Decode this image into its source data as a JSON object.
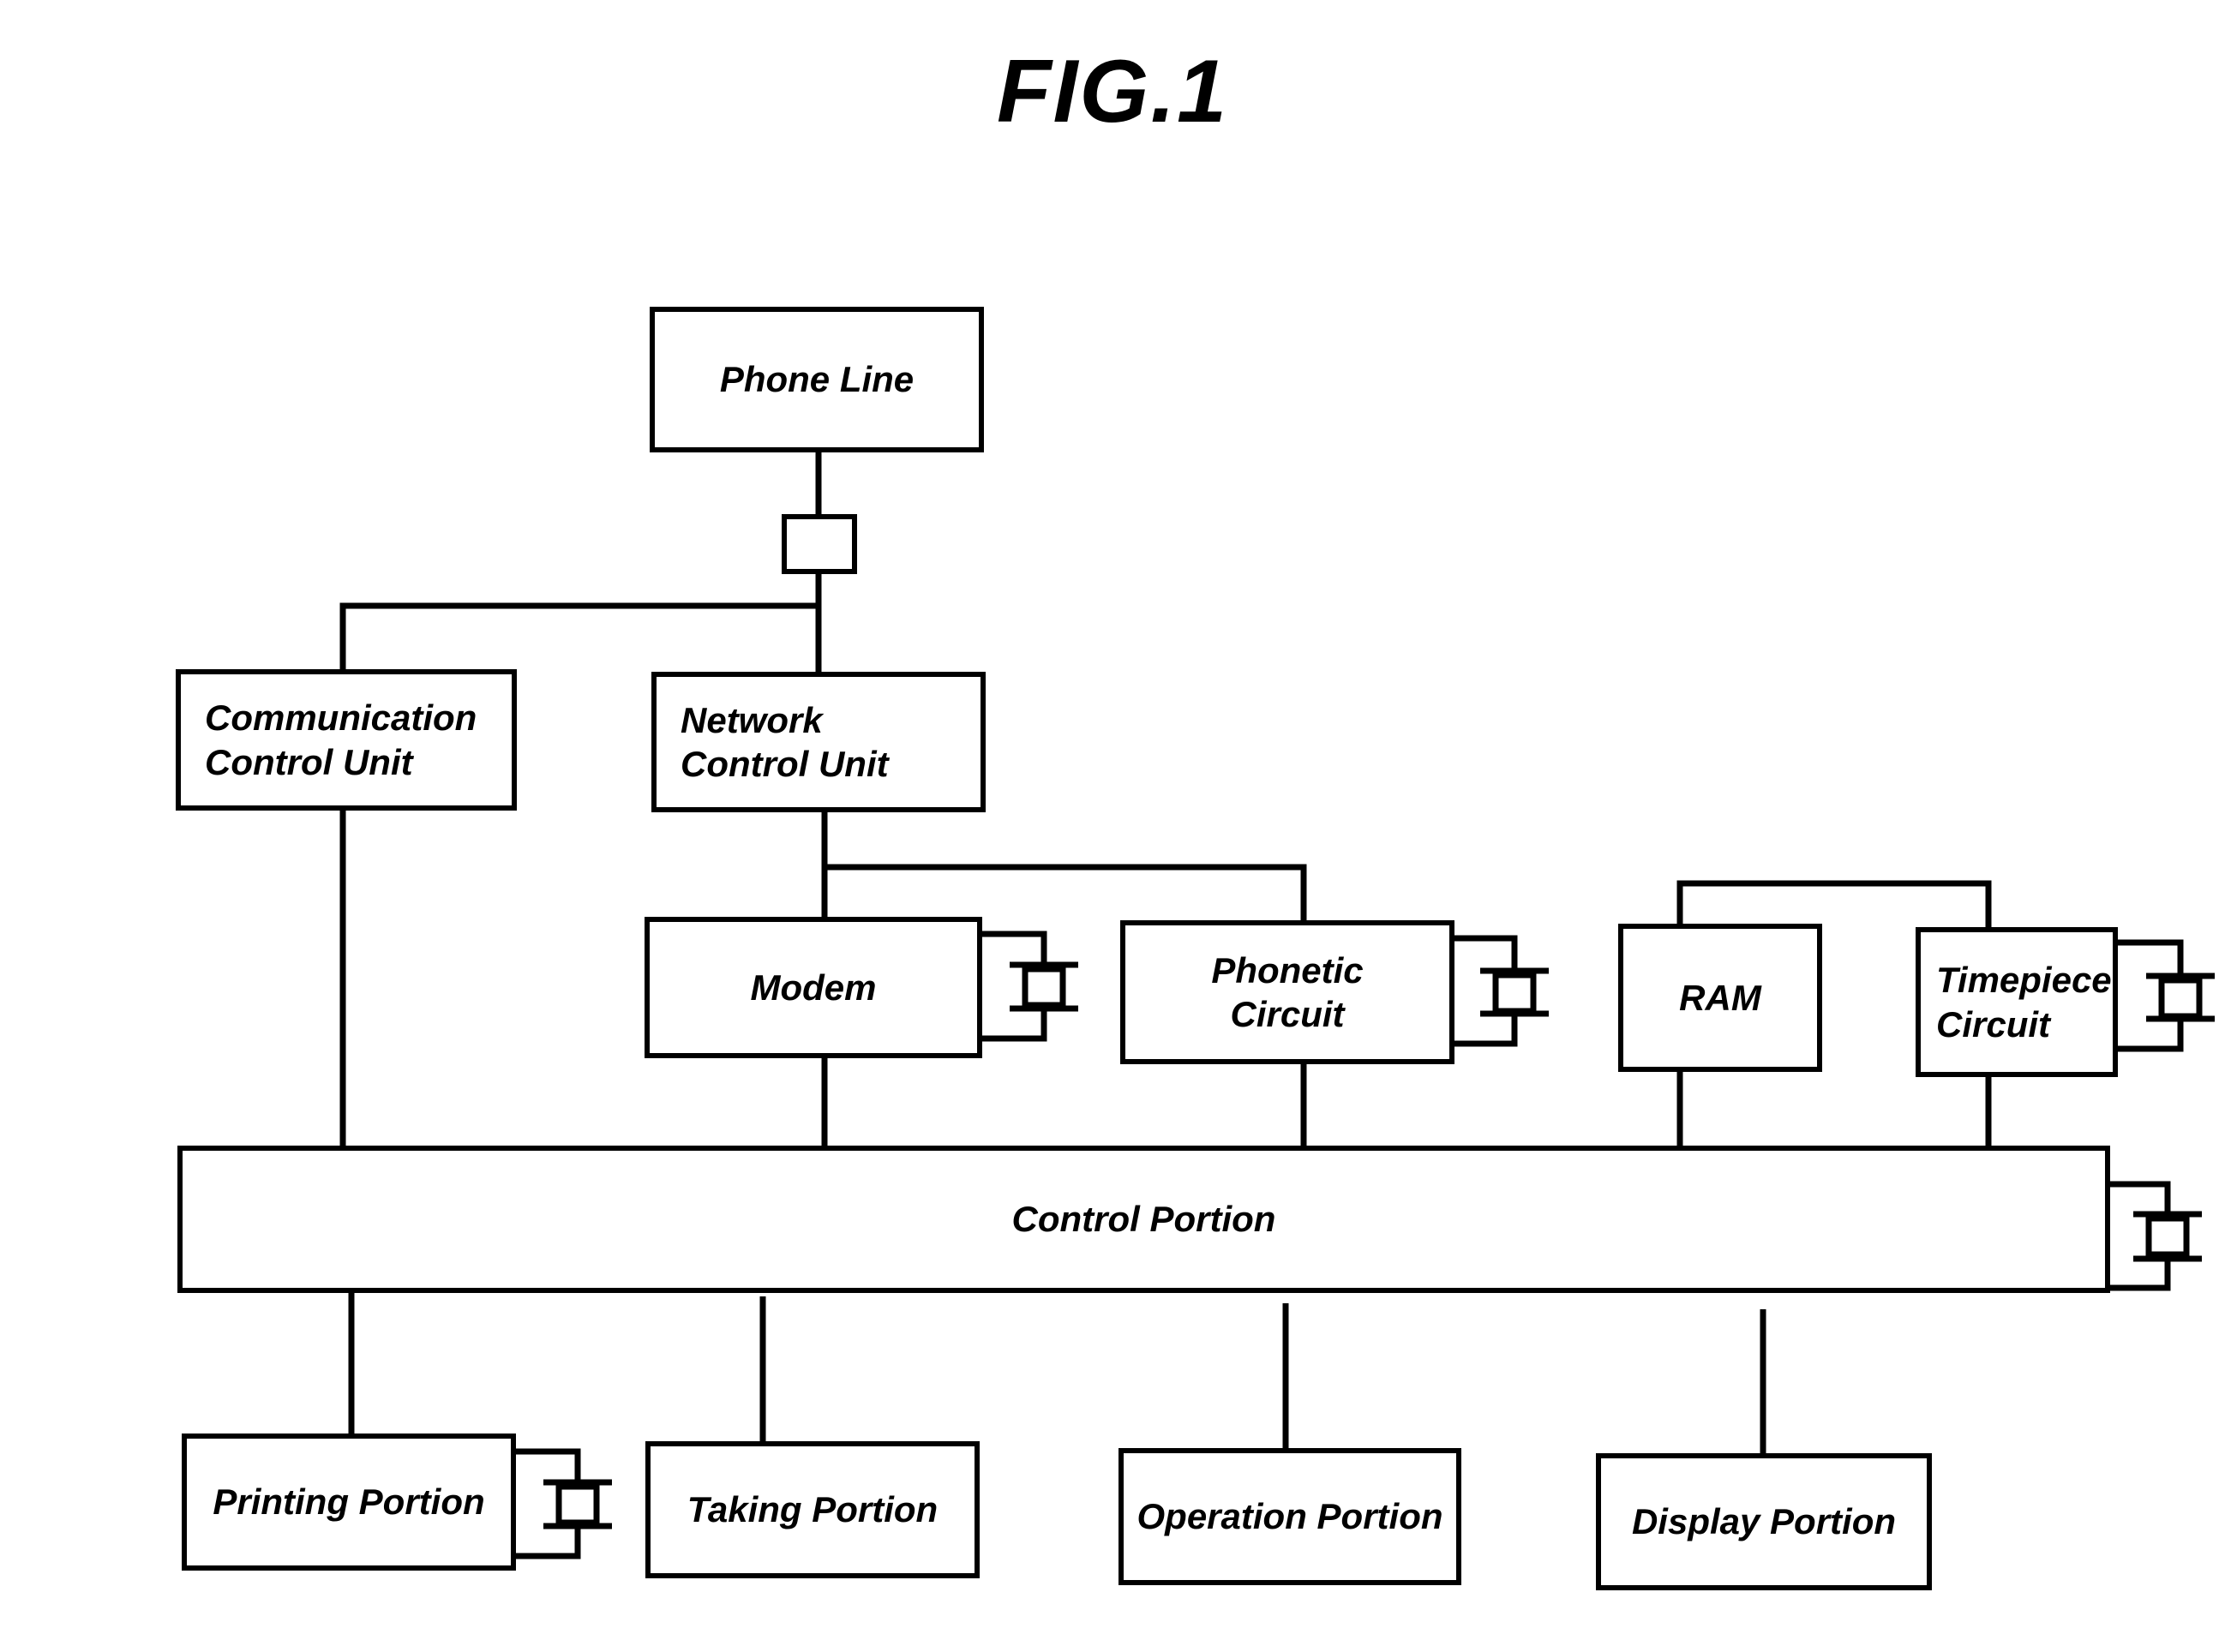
{
  "figure": {
    "title": "FIG.1",
    "kind": "block-diagram",
    "ink_color": "#000000",
    "background_color": "#ffffff"
  },
  "nodes": {
    "phone_line": {
      "label": "Phone Line",
      "align": "center"
    },
    "comm_ctrl": {
      "label": "Communication\nControl Unit",
      "align": "left"
    },
    "net_ctrl": {
      "label": "Network\nControl Unit",
      "align": "left"
    },
    "modem": {
      "label": "Modem",
      "align": "center"
    },
    "phonetic": {
      "label": "Phonetic\nCircuit",
      "align": "center"
    },
    "ram": {
      "label": "RAM",
      "align": "center"
    },
    "timepiece": {
      "label": "Timepiece\nCircuit",
      "align": "left"
    },
    "control": {
      "label": "Control Portion",
      "align": "center"
    },
    "printing": {
      "label": "Printing Portion",
      "align": "center"
    },
    "taking": {
      "label": "Taking Portion",
      "align": "center"
    },
    "operation": {
      "label": "Operation Portion",
      "align": "center"
    },
    "display": {
      "label": "Display Portion",
      "align": "center"
    }
  },
  "connectors": {
    "inline_jack": {
      "name": "line-jack-symbol",
      "count": 1
    },
    "side_terminal": {
      "name": "side-terminal-symbol",
      "count": 5,
      "attached_to": [
        "modem",
        "phonetic",
        "timepiece",
        "control",
        "printing"
      ]
    }
  },
  "edges": [
    {
      "from": "phone_line",
      "to": "inline-jack",
      "kind": "vertical"
    },
    {
      "from": "inline-jack",
      "to": "net_ctrl",
      "kind": "vertical"
    },
    {
      "from": "phone_line",
      "to": "comm_ctrl",
      "kind": "branch-left"
    },
    {
      "from": "net_ctrl",
      "to": "modem",
      "kind": "vertical"
    },
    {
      "from": "net_ctrl",
      "to": "phonetic",
      "kind": "branch-right"
    },
    {
      "from": "comm_ctrl",
      "to": "control",
      "kind": "vertical"
    },
    {
      "from": "modem",
      "to": "control",
      "kind": "vertical"
    },
    {
      "from": "phonetic",
      "to": "control",
      "kind": "vertical"
    },
    {
      "from": "ram",
      "to": "timepiece",
      "kind": "bridge-top"
    },
    {
      "from": "ram",
      "to": "control",
      "kind": "vertical"
    },
    {
      "from": "timepiece",
      "to": "control",
      "kind": "vertical"
    },
    {
      "from": "control",
      "to": "printing",
      "kind": "vertical"
    },
    {
      "from": "control",
      "to": "taking",
      "kind": "vertical"
    },
    {
      "from": "control",
      "to": "operation",
      "kind": "vertical"
    },
    {
      "from": "control",
      "to": "display",
      "kind": "vertical"
    }
  ]
}
